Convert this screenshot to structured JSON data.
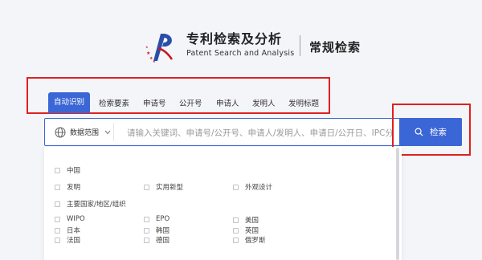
{
  "header": {
    "title_cn": "专利检索及分析",
    "title_en": "Patent Search and Analysis",
    "mode": "常规检索"
  },
  "tabs": [
    {
      "label": "自动识别",
      "active": true
    },
    {
      "label": "检索要素"
    },
    {
      "label": "申请号"
    },
    {
      "label": "公开号"
    },
    {
      "label": "申请人"
    },
    {
      "label": "发明人"
    },
    {
      "label": "发明标题"
    }
  ],
  "search": {
    "scope_label": "数据范围",
    "placeholder": "请输入关键词、申请号/公开号、申请人/发明人、申请日/公开日、IPC分...",
    "button_label": "检索"
  },
  "scope_panel": {
    "china": "中国",
    "china_types": [
      "发明",
      "实用新型",
      "外观设计"
    ],
    "regions_label": "主要国家/地区/组织",
    "regions": [
      "WIPO",
      "EPO",
      "美国",
      "日本",
      "韩国",
      "英国",
      "法国",
      "德国",
      "俄罗斯"
    ]
  },
  "colors": {
    "accent": "#3b66d6",
    "highlight": "#e02020"
  }
}
